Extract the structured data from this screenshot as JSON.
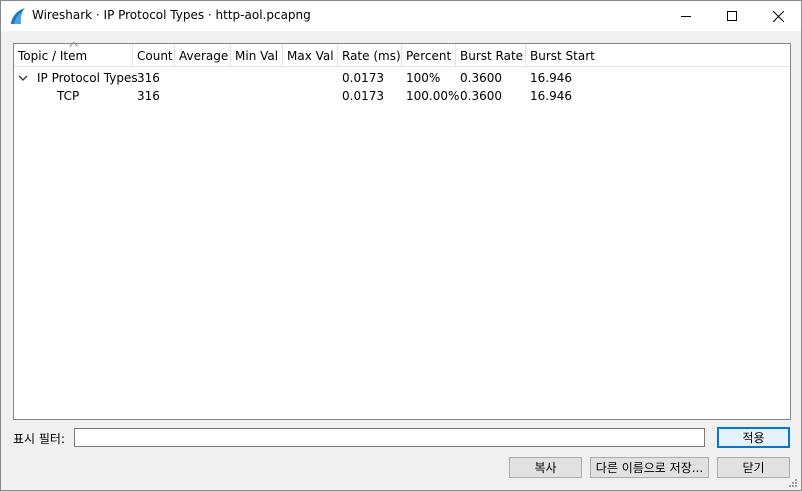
{
  "window": {
    "title": "Wireshark · IP Protocol Types · http-aol.pcapng",
    "controls": {
      "minimize": "minimize-icon",
      "maximize": "maximize-icon",
      "close": "close-icon"
    }
  },
  "table": {
    "columns": [
      "Topic / Item",
      "Count",
      "Average",
      "Min Val",
      "Max Val",
      "Rate (ms)",
      "Percent",
      "Burst Rate",
      "Burst Start"
    ],
    "rows": [
      {
        "topic": "IP Protocol Types",
        "count": "316",
        "average": "",
        "min_val": "",
        "max_val": "",
        "rate": "0.0173",
        "percent": "100%",
        "burst_rate": "0.3600",
        "burst_start": "16.946",
        "expanded": true
      },
      {
        "topic": "TCP",
        "count": "316",
        "average": "",
        "min_val": "",
        "max_val": "",
        "rate": "0.0173",
        "percent": "100.00%",
        "burst_rate": "0.3600",
        "burst_start": "16.946"
      }
    ]
  },
  "filter": {
    "label": "표시 필터:",
    "value": "",
    "apply_label": "적용"
  },
  "buttons": {
    "copy": "복사",
    "save_as": "다른 이름으로 저장...",
    "close": "닫기"
  },
  "colors": {
    "accent": "#0078d7",
    "tree_border": "#828790",
    "window_bg": "#f0f0f0"
  }
}
